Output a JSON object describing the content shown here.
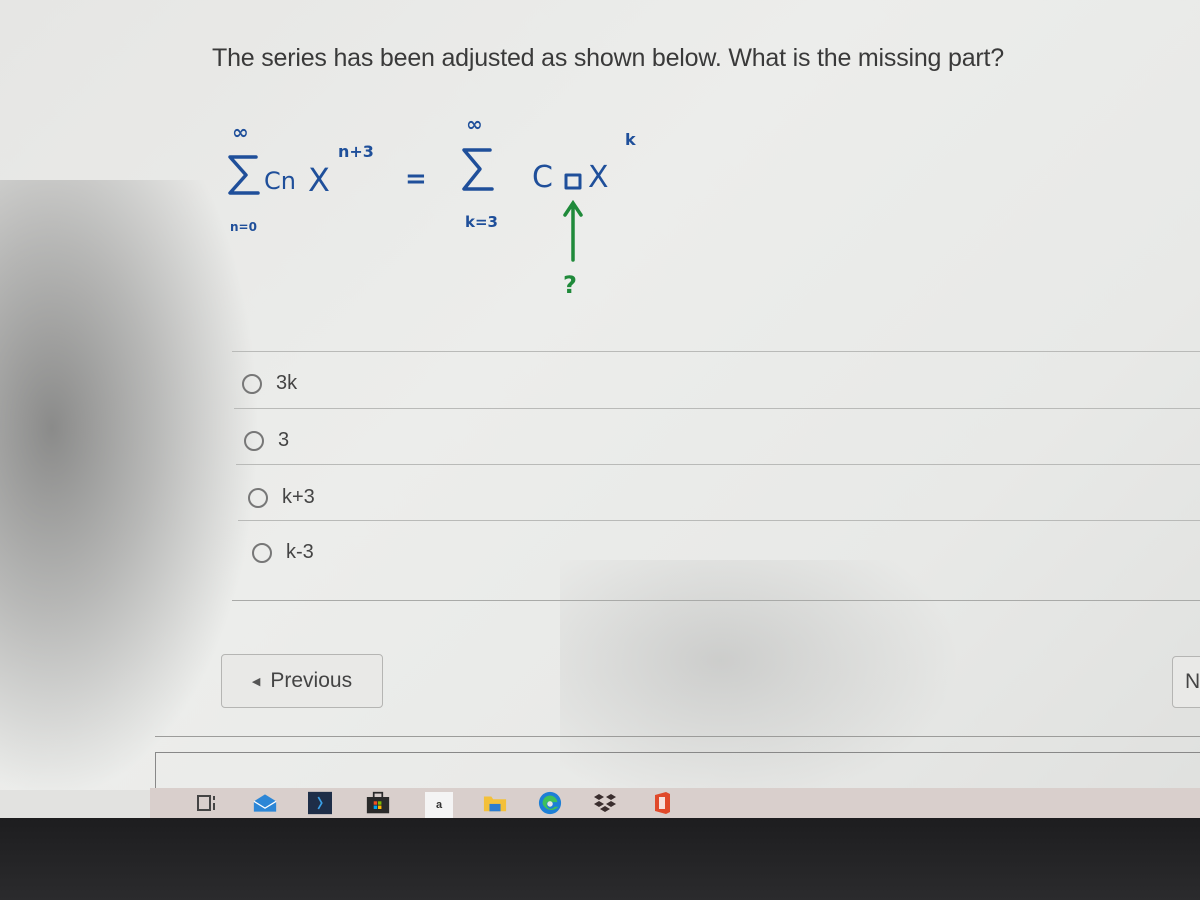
{
  "question": {
    "text": "The series has been adjusted as shown below. What is the missing part?"
  },
  "formula": {
    "left_sum_upper": "∞",
    "left_sum_lower": "n=0",
    "left_term": "Cn",
    "left_base": "X",
    "left_exponent": "n+3",
    "equals": "=",
    "right_sum_upper": "∞",
    "right_sum_lower": "k=3",
    "right_coef": "C",
    "right_base": "X",
    "right_exponent": "k",
    "missing_marker": "?",
    "ink_color": "#1f4f9a",
    "arrow_color": "#1f8a3a"
  },
  "options": [
    {
      "label": "3k",
      "selected": false
    },
    {
      "label": "3",
      "selected": false
    },
    {
      "label": "k+3",
      "selected": false
    },
    {
      "label": "k-3",
      "selected": false
    }
  ],
  "navigation": {
    "previous_label": "Previous",
    "next_label_partial": "N"
  },
  "taskbar": {
    "icons": [
      {
        "name": "task-view-icon"
      },
      {
        "name": "mail-icon"
      },
      {
        "name": "app-icon"
      },
      {
        "name": "microsoft-store-icon"
      },
      {
        "name": "amazon-icon",
        "glyph": "a"
      },
      {
        "name": "file-explorer-icon"
      },
      {
        "name": "edge-icon"
      },
      {
        "name": "dropbox-icon"
      },
      {
        "name": "office-icon"
      }
    ]
  }
}
